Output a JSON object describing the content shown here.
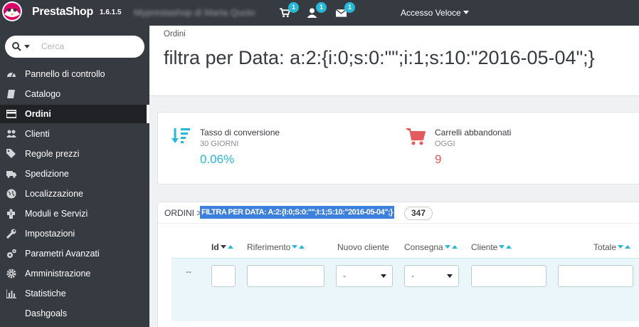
{
  "header": {
    "brand": "PrestaShop",
    "version": "1.6.1.5",
    "shop_name": "Myprestashop di Marta Quoio",
    "orders_badge": "1",
    "customers_badge": "1",
    "messages_badge": "1",
    "quick_access": "Accesso Veloce"
  },
  "sidebar": {
    "search_placeholder": "Cerca",
    "items": [
      {
        "label": "Pannello di controllo",
        "icon": "dashboard-icon"
      },
      {
        "label": "Catalogo",
        "icon": "book-icon"
      },
      {
        "label": "Ordini",
        "icon": "credit-card-icon",
        "active": true
      },
      {
        "label": "Clienti",
        "icon": "users-icon"
      },
      {
        "label": "Regole prezzi",
        "icon": "tags-icon"
      },
      {
        "label": "Spedizione",
        "icon": "truck-icon"
      },
      {
        "label": "Localizzazione",
        "icon": "globe-icon"
      },
      {
        "label": "Moduli e Servizi",
        "icon": "puzzle-icon"
      },
      {
        "label": "Impostazioni",
        "icon": "wrench-icon"
      },
      {
        "label": "Parametri Avanzati",
        "icon": "cogs-icon"
      },
      {
        "label": "Amministrazione",
        "icon": "gear-icon"
      },
      {
        "label": "Statistiche",
        "icon": "bar-chart-icon"
      },
      {
        "label": "Dashgoals",
        "icon": ""
      }
    ]
  },
  "page": {
    "breadcrumb": "Ordini",
    "title": "filtra per Data: a:2:{i:0;s:0:\"\";i:1;s:10:\"2016-05-04\";}"
  },
  "kpis": [
    {
      "title": "Tasso di conversione",
      "period": "30 GIORNI",
      "value": "0.06%",
      "icon": "sort-amount-desc-icon",
      "color": "#25b9d7"
    },
    {
      "title": "Carrelli abbandonati",
      "period": "OGGI",
      "value": "9",
      "icon": "shopping-cart-icon",
      "color": "#e35b5b"
    }
  ],
  "panel": {
    "crumb": "ORDINI >",
    "filter_label": "FILTRA PER DATA: A:2:{I:0;S:0:\"\";I:1;S:10:\"2016-05-04\";}",
    "count": "347"
  },
  "table": {
    "columns": [
      {
        "label": "Id",
        "bold": true
      },
      {
        "label": "Riferimento"
      },
      {
        "label": "Nuovo cliente"
      },
      {
        "label": "Consegna"
      },
      {
        "label": "Cliente"
      },
      {
        "label": "Totale"
      }
    ],
    "filter_row": {
      "bulk_placeholder": "--",
      "new_client_select": "-",
      "delivery_select": "-"
    }
  },
  "colors": {
    "accent": "#25b9d7",
    "danger": "#e35b5b",
    "dark": "#363a41"
  }
}
